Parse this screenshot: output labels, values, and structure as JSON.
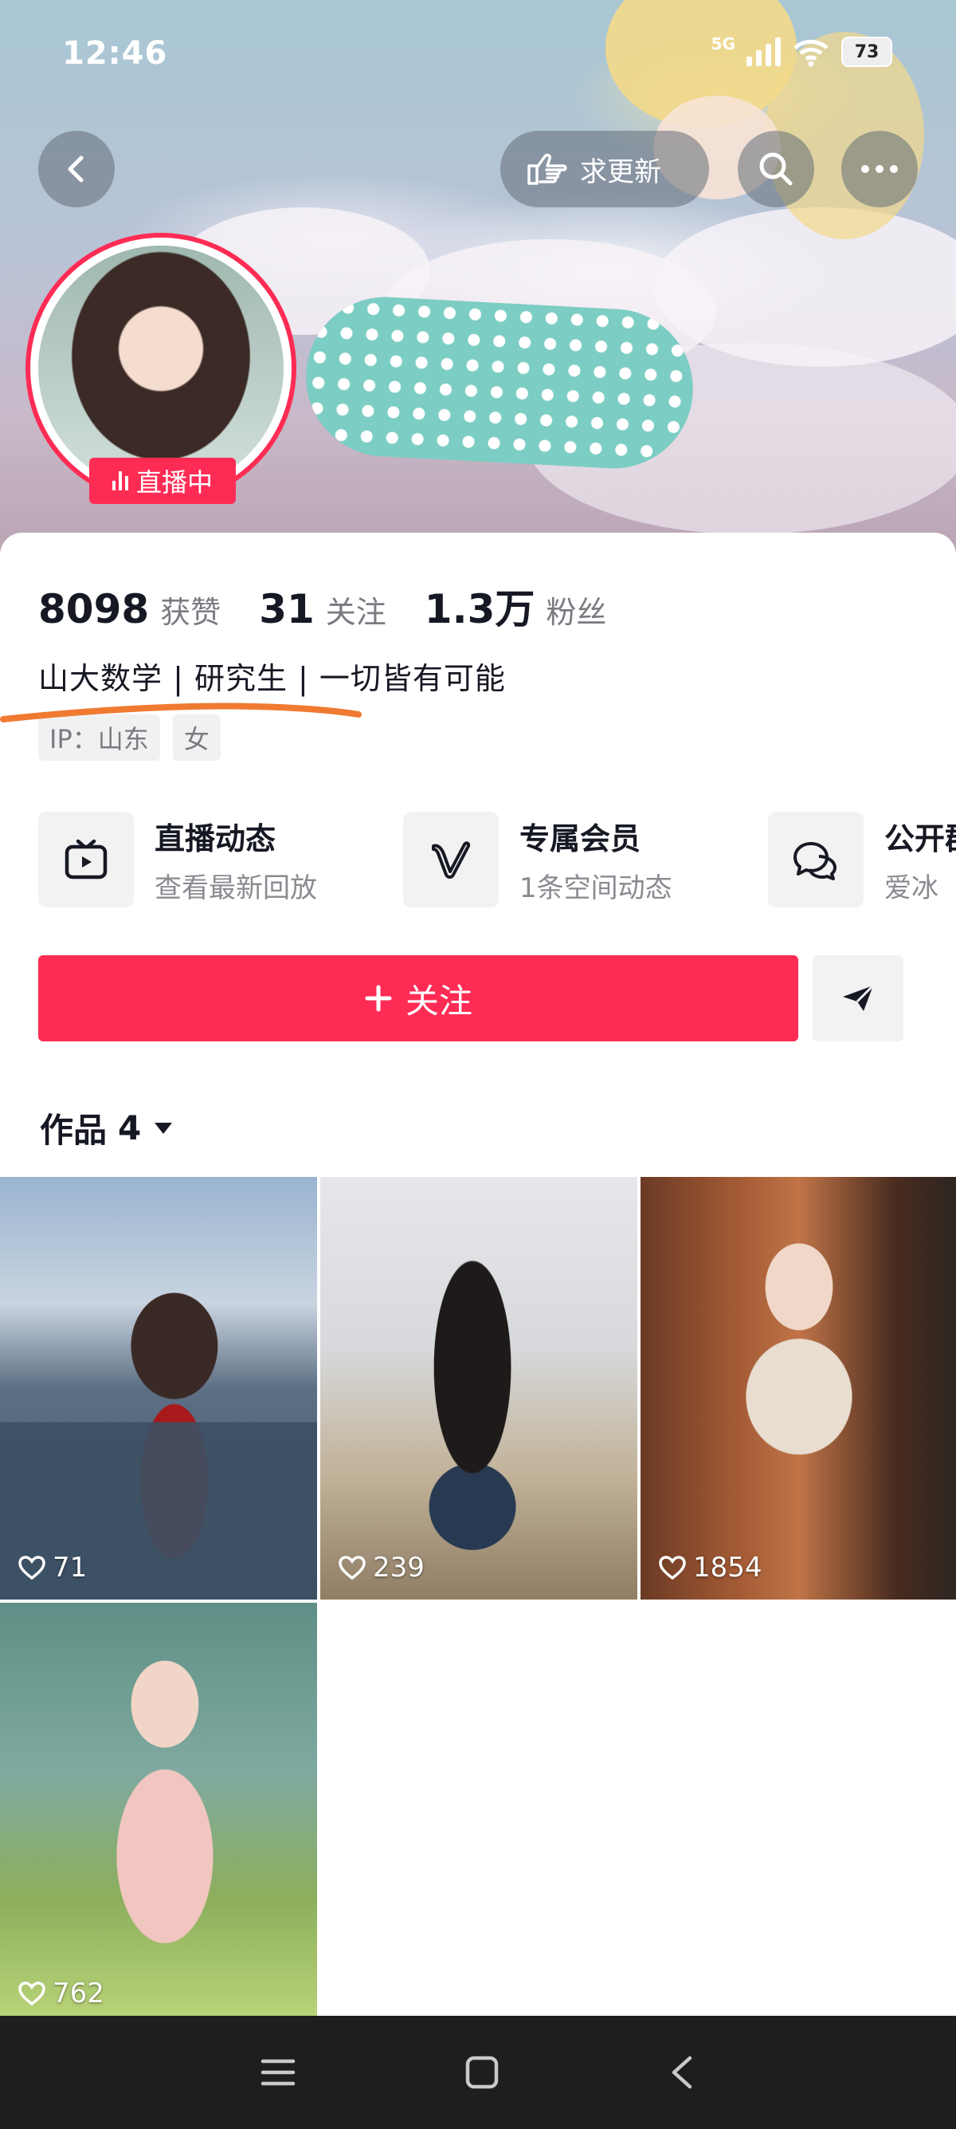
{
  "status_bar": {
    "time": "12:46",
    "network": "5G",
    "battery": "73"
  },
  "header": {
    "request_update_label": "求更新"
  },
  "profile": {
    "live_badge": "直播中"
  },
  "stats": [
    {
      "value": "8098",
      "label": "获赞"
    },
    {
      "value": "31",
      "label": "关注"
    },
    {
      "value": "1.3万",
      "label": "粉丝"
    }
  ],
  "bio": "山大数学 | 研究生 | 一切皆有可能",
  "tags": {
    "ip": "IP：山东",
    "gender": "女"
  },
  "shortcuts": [
    {
      "title": "直播动态",
      "subtitle": "查看最新回放",
      "icon": "tv-icon"
    },
    {
      "title": "专属会员",
      "subtitle": "1条空间动态",
      "icon": "v-icon"
    },
    {
      "title": "公开群",
      "subtitle": "爱冰",
      "icon": "chat-icon"
    }
  ],
  "actions": {
    "follow_label": "关注"
  },
  "works": {
    "label": "作品",
    "count": "4",
    "items": [
      {
        "likes": "71"
      },
      {
        "likes": "239"
      },
      {
        "likes": "1854"
      },
      {
        "likes": "762"
      }
    ]
  },
  "colors": {
    "accent": "#fe2c55",
    "nav_bg": "#1e1e1f"
  }
}
